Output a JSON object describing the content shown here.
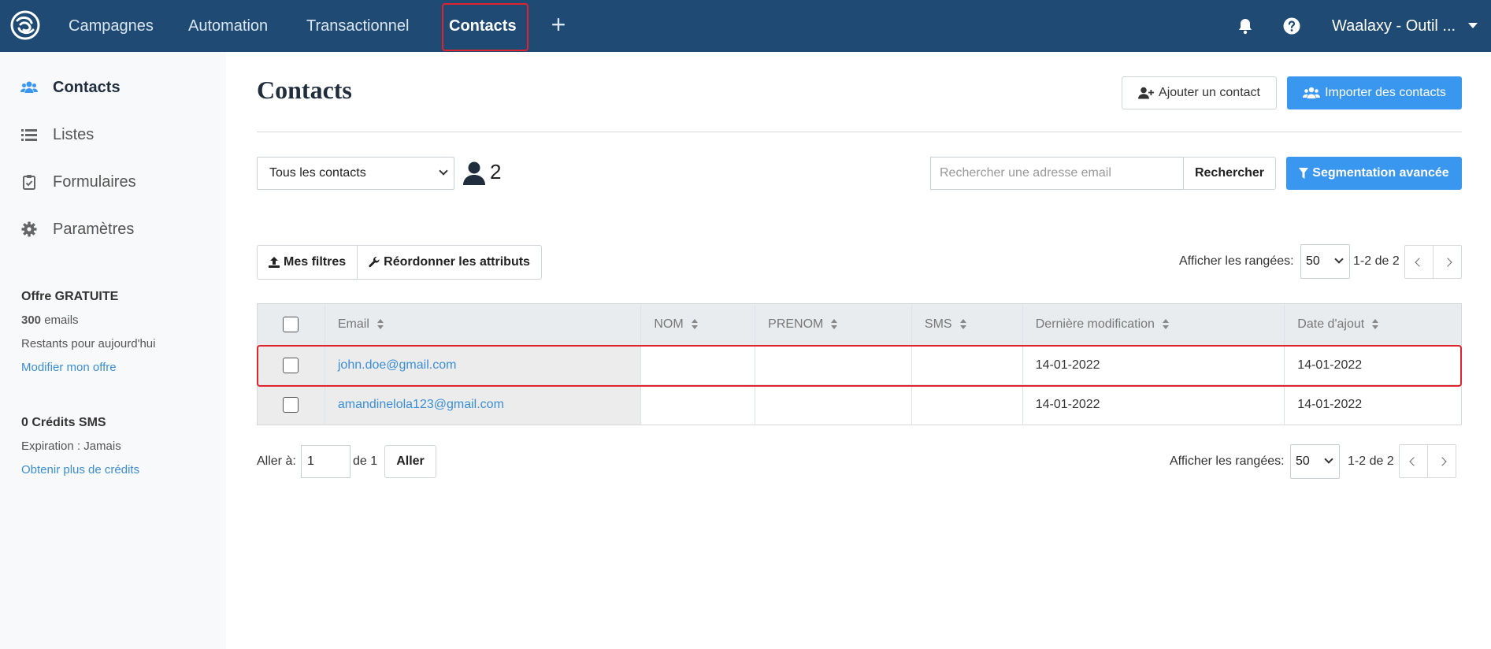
{
  "nav": {
    "items": [
      "Campagnes",
      "Automation",
      "Transactionnel",
      "Contacts"
    ],
    "org_name": "Waalaxy - Outil ..."
  },
  "sidebar": {
    "items": [
      "Contacts",
      "Listes",
      "Formulaires",
      "Paramètres"
    ],
    "plan_title": "Offre GRATUITE",
    "emails_count": "300",
    "emails_label": " emails",
    "remaining": "Restants pour aujourd'hui",
    "modify_link": "Modifier mon offre",
    "sms_title": "0 Crédits SMS",
    "expiration": "Expiration : Jamais",
    "more_credits": "Obtenir plus de crédits"
  },
  "page": {
    "title": "Contacts",
    "add_contact": "Ajouter un contact",
    "import_contacts": "Importer des contacts"
  },
  "toolbar": {
    "list_select": "Tous les contacts",
    "contact_count": "2",
    "search_placeholder": "Rechercher une adresse email",
    "search_button": "Rechercher",
    "segmentation": "Segmentation avancée",
    "my_filters": "Mes filtres",
    "reorder": "Réordonner les attributs",
    "rows_label": "Afficher les rangées:",
    "rows_value": "50",
    "range": "1-2 de 2"
  },
  "table": {
    "columns": [
      "Email",
      "NOM",
      "PRENOM",
      "SMS",
      "Dernière modification",
      "Date d'ajout"
    ],
    "rows": [
      {
        "email": "john.doe@gmail.com",
        "nom": "",
        "prenom": "",
        "sms": "",
        "modified": "14-01-2022",
        "added": "14-01-2022"
      },
      {
        "email": "amandinelola123@gmail.com",
        "nom": "",
        "prenom": "",
        "sms": "",
        "modified": "14-01-2022",
        "added": "14-01-2022"
      }
    ]
  },
  "footer": {
    "goto_label": "Aller à:",
    "goto_value": "1",
    "of_label": "de 1",
    "go_button": "Aller",
    "rows_label": "Afficher les rangées:",
    "rows_value": "50",
    "range": "1-2 de 2"
  },
  "colors": {
    "nav_bg": "#1e4a73",
    "primary": "#3a97f0",
    "highlight": "#e0242e",
    "link": "#3a8ed6"
  }
}
